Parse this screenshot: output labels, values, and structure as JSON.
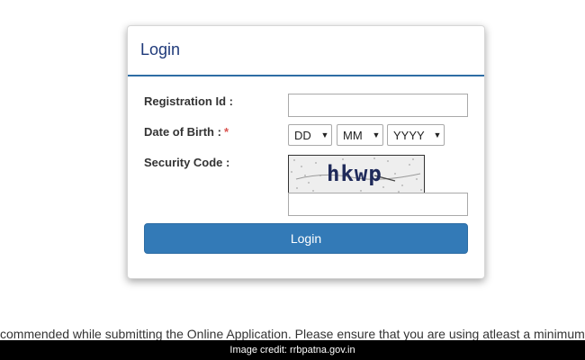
{
  "login_panel": {
    "title": "Login",
    "fields": {
      "registration_id_label": "Registration Id :",
      "registration_id_value": "",
      "dob_label": "Date of Birth :",
      "dob_required_mark": "*",
      "dob_day": "DD",
      "dob_month": "MM",
      "dob_year": "YYYY",
      "security_code_label": "Security Code :",
      "captcha_text": "hkwp",
      "security_code_value": ""
    },
    "login_button": "Login"
  },
  "notice_text": "commended while submitting the Online Application. Please ensure that you are using atleast a minimum",
  "image_credit": "Image credit: rrbpatna.gov.in",
  "colors": {
    "title": "#1f3a7a",
    "header_rule": "#2e6da4",
    "button": "#337ab7",
    "required": "#d9534f"
  }
}
